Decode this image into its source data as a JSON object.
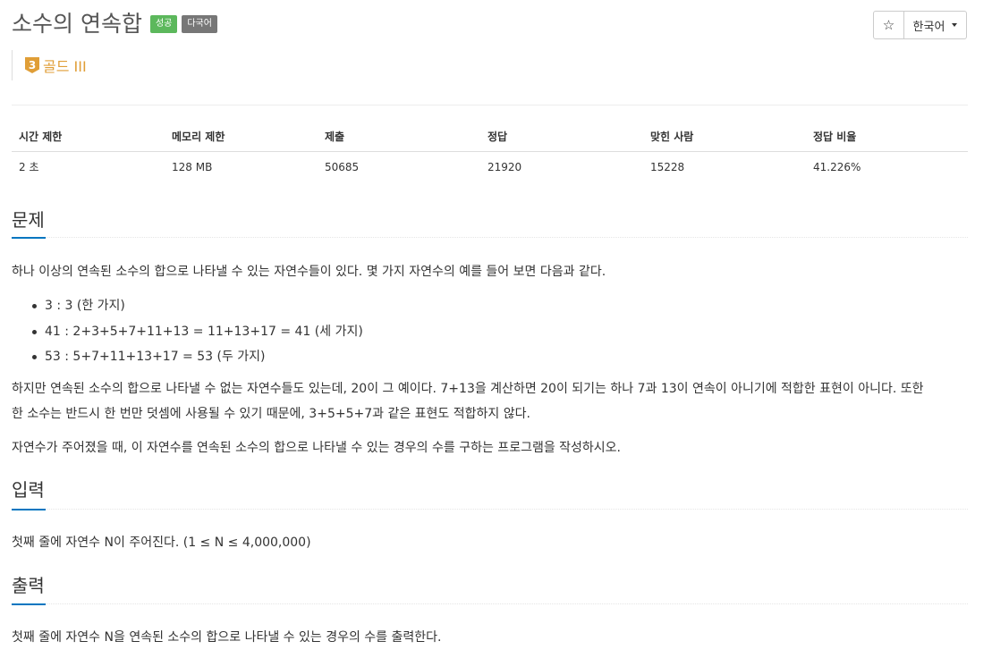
{
  "problem": {
    "title": "소수의 연속합",
    "badges": [
      {
        "label": "성공",
        "color": "#5cb85c"
      },
      {
        "label": "다국어",
        "color": "#777777"
      }
    ],
    "tier": {
      "number": "3",
      "label": "골드 III",
      "color": "#e09e37"
    }
  },
  "toolbar": {
    "star_glyph": "☆",
    "language_label": "한국어"
  },
  "info_table": {
    "headers": [
      "시간 제한",
      "메모리 제한",
      "제출",
      "정답",
      "맞힌 사람",
      "정답 비율"
    ],
    "values": [
      "2 초",
      "128 MB",
      "50685",
      "21920",
      "15228",
      "41.226%"
    ]
  },
  "sections": {
    "problem": {
      "heading": "문제",
      "intro": "하나 이상의 연속된 소수의 합으로 나타낼 수 있는 자연수들이 있다. 몇 가지 자연수의 예를 들어 보면 다음과 같다.",
      "examples": [
        "3 : 3 (한 가지)",
        "41 : 2+3+5+7+11+13 = 11+13+17 = 41 (세 가지)",
        "53 : 5+7+11+13+17 = 53 (두 가지)"
      ],
      "para2_line1": "하지만 연속된 소수의 합으로 나타낼 수 없는 자연수들도 있는데, 20이 그 예이다. 7+13을 계산하면 20이 되기는 하나 7과 13이 연속이 아니기에 적합한 표현이 아니다. 또한",
      "para2_line2": "한 소수는 반드시 한 번만 덧셈에 사용될 수 있기 때문에, 3+5+5+7과 같은 표현도 적합하지 않다.",
      "para3": "자연수가 주어졌을 때, 이 자연수를 연속된 소수의 합으로 나타낼 수 있는 경우의 수를 구하는 프로그램을 작성하시오."
    },
    "input": {
      "heading": "입력",
      "text": "첫째 줄에 자연수 N이 주어진다. (1 ≤ N ≤ 4,000,000)"
    },
    "output": {
      "heading": "출력",
      "text": "첫째 줄에 자연수 N을 연속된 소수의 합으로 나타낼 수 있는 경우의 수를 출력한다."
    }
  },
  "colors": {
    "accent_underline": "#0076c0",
    "tier_gold": "#e09e37"
  }
}
